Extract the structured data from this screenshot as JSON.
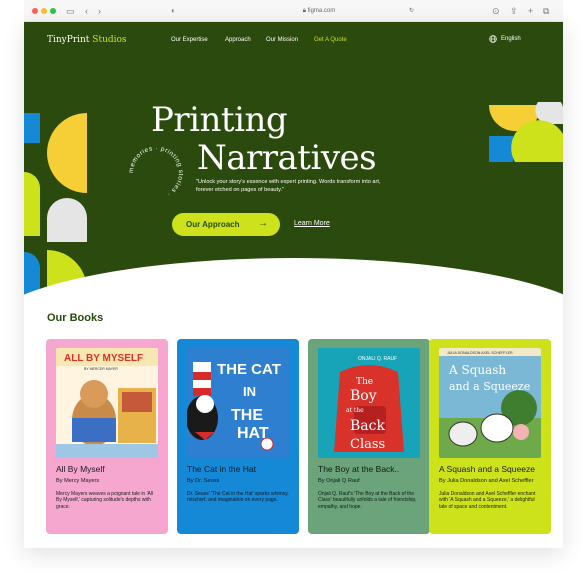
{
  "browser": {
    "url": "figma.com",
    "lock_icon": "lock-icon",
    "reload_icon": "reload-icon"
  },
  "colors": {
    "hero_bg": "#2b4a0d",
    "accent": "#cde21a",
    "yellow": "#f5cf35",
    "blue": "#1589d6",
    "grey": "#e5e5e5"
  },
  "brand": {
    "name": "TinyPrint",
    "name_accent": "Studios"
  },
  "nav": {
    "items": [
      {
        "label": "Our Expertise"
      },
      {
        "label": "Approach"
      },
      {
        "label": "Our Mission"
      },
      {
        "label": "Get A Quote"
      }
    ],
    "language": "English"
  },
  "hero": {
    "title_line1": "Printing",
    "title_line2": "Narratives",
    "ring_text": "memories · printing stories · ",
    "tagline": "\"Unlock your story's essence with expert printing. Words transform into art, forever etched on pages of beauty.\"",
    "primary_cta": "Our Approach",
    "secondary_cta": "Learn More"
  },
  "books_section": {
    "title": "Our Books",
    "books": [
      {
        "title": "All By Myself",
        "author": "By Mercy Mayers",
        "description": "Mercy Mayers weaves a poignant tale in 'All By Myself,' capturing solitude's depths with grace.",
        "card_color": "#f5a7cf",
        "text_color": "#1b1b1b",
        "cover_text": "ALL BY MYSELF",
        "cover_sub": "BY MERCER MAYER",
        "cover_bg": "#fff4e0"
      },
      {
        "title": "The Cat in the Hat",
        "author": "By Dr. Seuss",
        "description": "Dr. Seuss' 'The Cat in the Hat' sparks whimsy, mischief, and imagination on every page.",
        "card_color": "#1589d6",
        "text_color": "#0e1a2a",
        "cover_text": "THE CAT IN THE HAT",
        "cover_sub": "",
        "cover_bg": "#2f7fd0"
      },
      {
        "title": "The Boy at the Back..",
        "author": "By Onjali Q Rauf",
        "description": "Onjali Q. Rauf's 'The Boy at the Back of the Class' beautifully unfolds a tale of friendship, empathy, and hope.",
        "card_color": "#6ba37a",
        "text_color": "#0f1f12",
        "cover_text": "The Boy at the Back of the Class",
        "cover_sub": "ONJALI Q. RAUF",
        "cover_bg": "#18a4b8"
      },
      {
        "title": "A Squash and a Squeeze",
        "author": "By Julia Donaldson and Axel Scheffler",
        "description": "Julia Donaldson and Axel Scheffler enchant with 'A Squash and a Squeeze,' a delightful tale of space and contentment.",
        "card_color": "#cde21a",
        "text_color": "#16200a",
        "cover_text": "A Squash and a Squeeze",
        "cover_sub": "JULIA DONALDSON AXEL SCHEFFLER",
        "cover_bg": "#7bb8d6"
      }
    ]
  }
}
